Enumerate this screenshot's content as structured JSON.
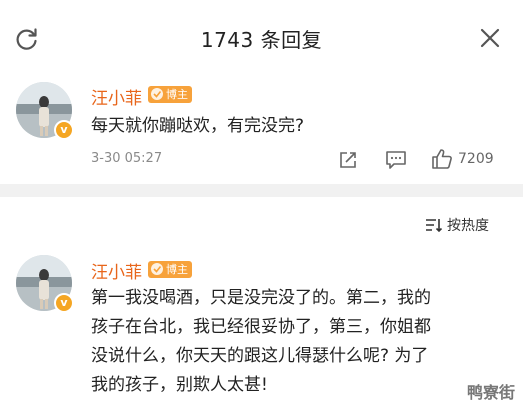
{
  "header": {
    "title": "1743 条回复"
  },
  "icons": {
    "refresh": "refresh-icon",
    "close": "close-icon",
    "share": "share-icon",
    "comment": "comment-icon",
    "like": "like-icon",
    "sort": "sort-icon"
  },
  "colors": {
    "username": "#e8651a",
    "badge": "#f7a23b",
    "verified": "#f5a623"
  },
  "comments": [
    {
      "username": "汪小菲",
      "badge": "博主",
      "verified_mark": "v",
      "text": "每天就你蹦哒欢，有完没完?",
      "time": "3-30 05:27",
      "likes": "7209"
    },
    {
      "username": "汪小菲",
      "badge": "博主",
      "verified_mark": "v",
      "lines": [
        "第一我没喝酒，只是没完没了的。第二，我的",
        "孩子在台北，我已经很妥协了，第三，你姐都",
        "没说什么，你天天的跟这儿得瑟什么呢? 为了",
        "我的孩子，别欺人太甚!"
      ]
    }
  ],
  "sort": {
    "label": "按热度"
  },
  "watermark": "鸭寮街"
}
